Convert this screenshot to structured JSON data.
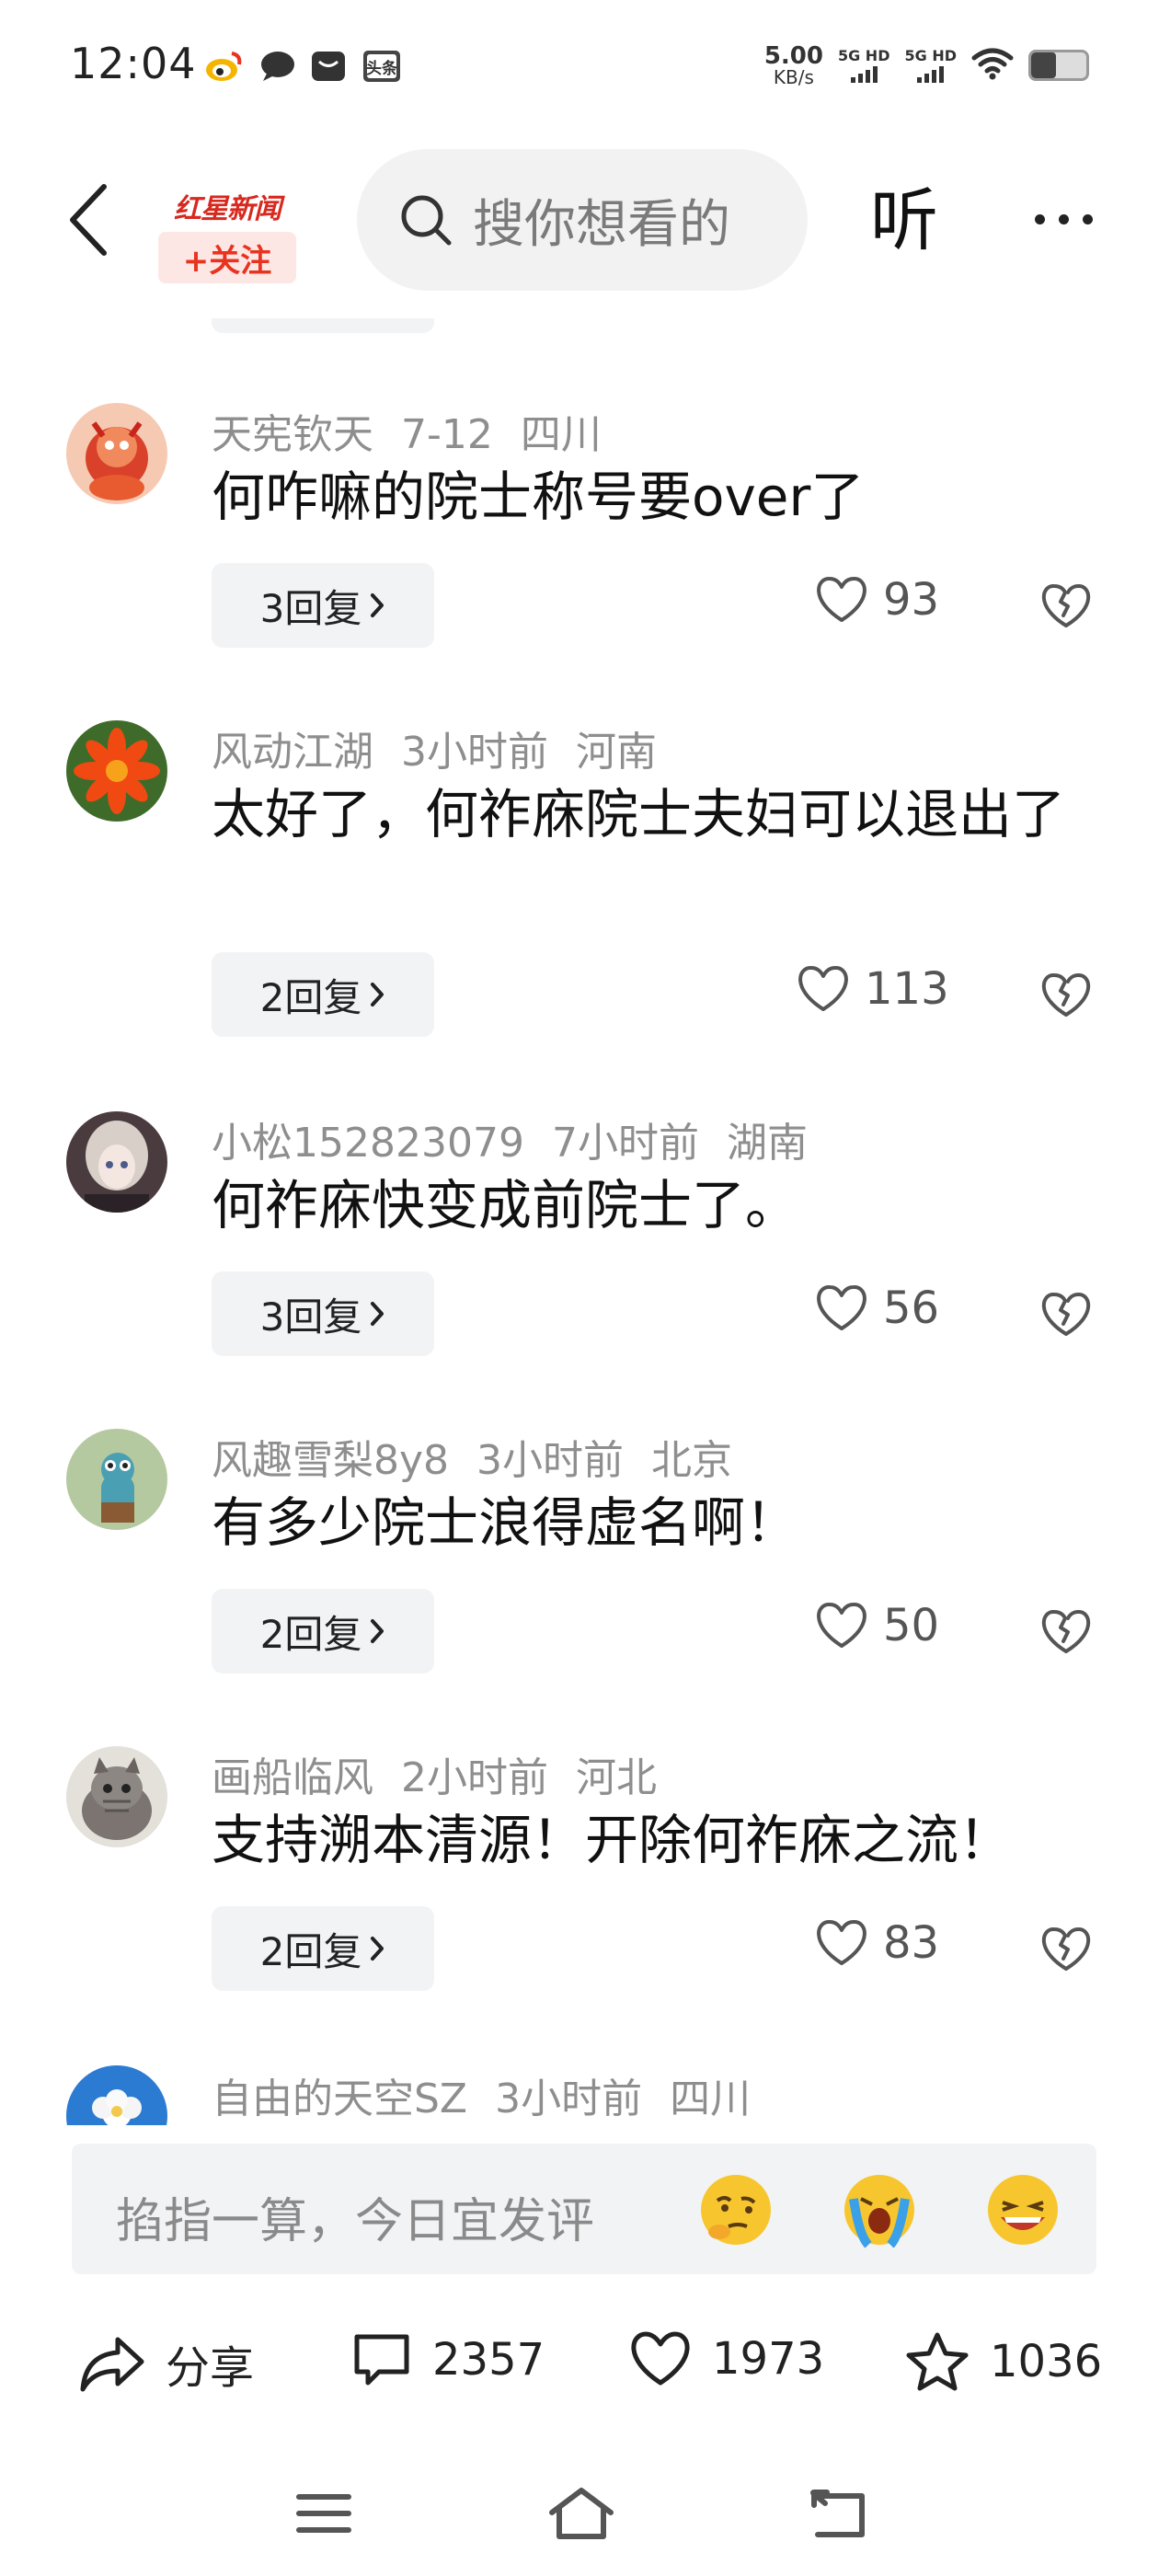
{
  "status_bar": {
    "time": "12:04",
    "net_speed_value": "5.00",
    "net_speed_unit": "KB/s",
    "sim1_label": "5G HD",
    "sim2_label": "5G HD",
    "battery_level": 0.45,
    "notif_icons": [
      "weibo-icon",
      "message-bubble-icon",
      "mail-icon",
      "toutiao-icon"
    ],
    "toutiao_label": "头条"
  },
  "header": {
    "logo_text": "红星新闻",
    "follow_label": "+关注",
    "search_placeholder": "搜你想看的",
    "listen_label": "听"
  },
  "comments": [
    {
      "user": "天宪钦天",
      "time": "7-12",
      "location": "四川",
      "text": "何咋嘛的院士称号要over了",
      "replies": "3回复",
      "likes": "93"
    },
    {
      "user": "风动江湖",
      "time": "3小时前",
      "location": "河南",
      "text": "太好了，何祚庥院士夫妇可以退出了",
      "replies": "2回复",
      "likes": "113"
    },
    {
      "user": "小松152823079",
      "time": "7小时前",
      "location": "湖南",
      "text": "何祚庥快变成前院士了。",
      "replies": "3回复",
      "likes": "56"
    },
    {
      "user": "风趣雪梨8y8",
      "time": "3小时前",
      "location": "北京",
      "text": "有多少院士浪得虚名啊！",
      "replies": "2回复",
      "likes": "50"
    },
    {
      "user": "画船临风",
      "time": "2小时前",
      "location": "河北",
      "text": "支持溯本清源！开除何祚庥之流！",
      "replies": "2回复",
      "likes": "83"
    },
    {
      "user": "自由的天空SZ",
      "time": "3小时前",
      "location": "四川"
    }
  ],
  "comment_input": {
    "placeholder": "掐指一算，今日宜发评"
  },
  "actions": {
    "share_label": "分享",
    "comments_count": "2357",
    "likes_count": "1973",
    "favorites_count": "1036"
  },
  "colors": {
    "brand_red": "#d7291f",
    "follow_bg": "#fde7e5",
    "pill_bg": "#f2f3f5",
    "meta_gray": "#8e8e8e"
  }
}
